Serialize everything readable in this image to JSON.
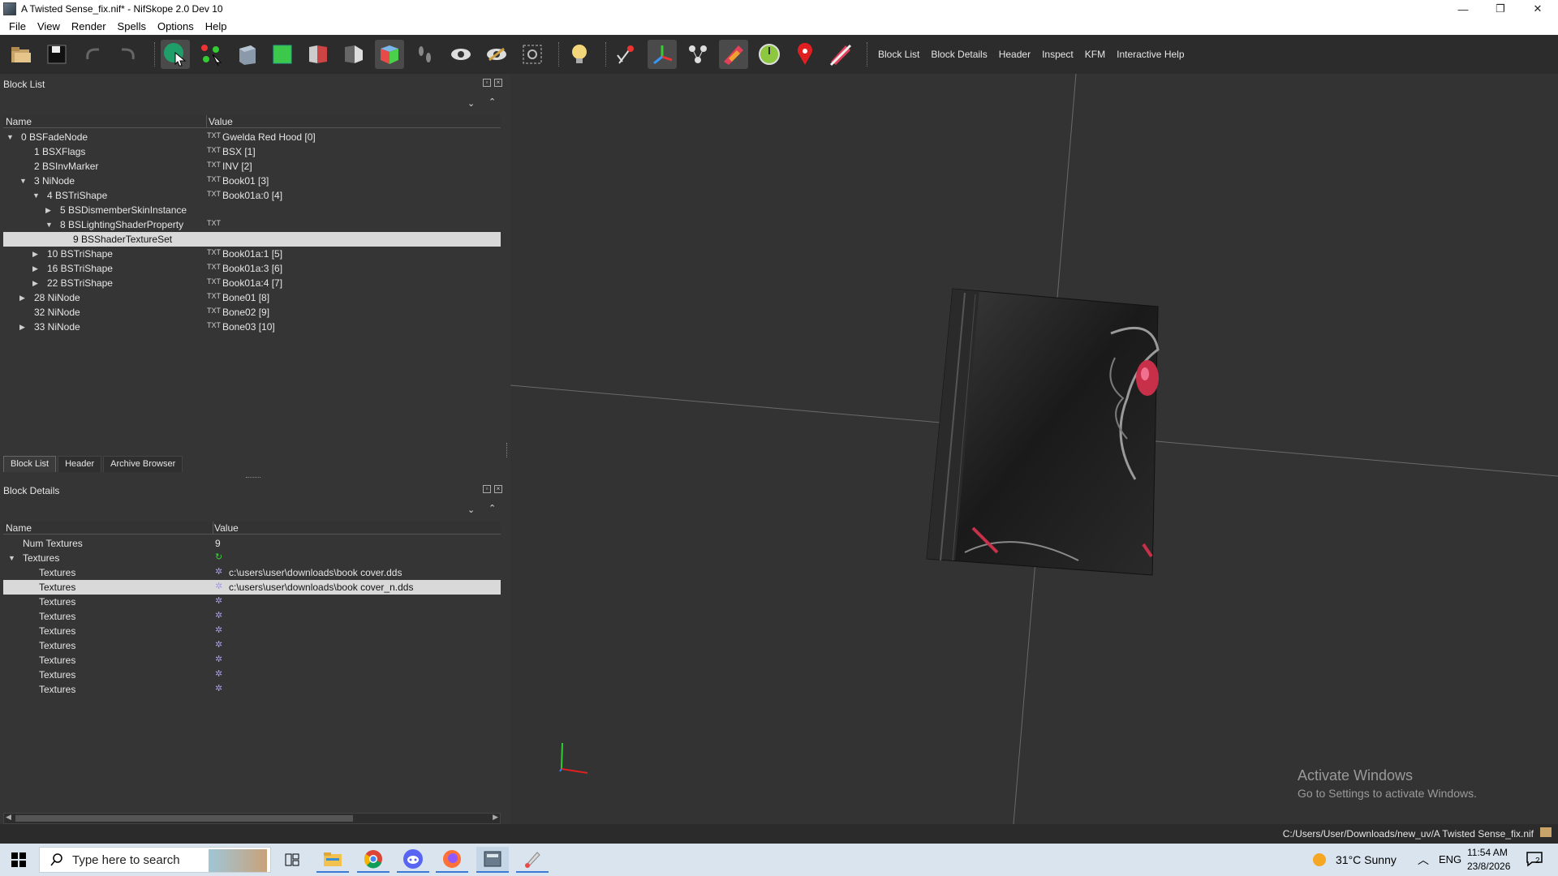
{
  "window": {
    "title": "A Twisted Sense_fix.nif* - NifSkope 2.0 Dev 10",
    "minimize_glyph": "—",
    "restore_glyph": "❐",
    "close_glyph": "✕"
  },
  "menu": [
    "File",
    "View",
    "Render",
    "Spells",
    "Options",
    "Help"
  ],
  "toolbar": {
    "icons": [
      "load-icon",
      "save-icon",
      "undo-icon",
      "redo-icon",
      "select-object-icon",
      "select-vertex-icon",
      "view-box-icon",
      "view-front-icon",
      "view-side-icon",
      "view-flip-icon",
      "view-perspective-icon",
      "walk-icon",
      "show-icon",
      "hide-icon",
      "screenshot-icon",
      "lighting-icon",
      "pick-icon",
      "axes-icon",
      "nodes-icon",
      "textures-icon",
      "color-wheel-icon",
      "marker-icon",
      "no-textures-icon"
    ],
    "labels": [
      "Block List",
      "Block Details",
      "Header",
      "Inspect",
      "KFM",
      "Interactive Help"
    ]
  },
  "block_list": {
    "title": "Block List",
    "col_name": "Name",
    "col_value": "Value",
    "rows": [
      {
        "arrow": "▼",
        "name": "0 BSFadeNode",
        "value": "Gwelda Red Hood [0]"
      },
      {
        "arrow": "",
        "name": "1 BSXFlags",
        "value": "BSX [1]"
      },
      {
        "arrow": "",
        "name": "2 BSInvMarker",
        "value": "INV [2]"
      },
      {
        "arrow": "▼",
        "name": "3 NiNode",
        "value": "Book01 [3]"
      },
      {
        "arrow": "▼",
        "name": "4 BSTriShape",
        "value": "Book01a:0 [4]"
      },
      {
        "arrow": "▶",
        "name": "5 BSDismemberSkinInstance",
        "value": ""
      },
      {
        "arrow": "▼",
        "name": "8 BSLightingShaderProperty",
        "value": ""
      },
      {
        "arrow": "",
        "name": "9 BSShaderTextureSet",
        "value": ""
      },
      {
        "arrow": "▶",
        "name": "10 BSTriShape",
        "value": "Book01a:1 [5]"
      },
      {
        "arrow": "▶",
        "name": "16 BSTriShape",
        "value": "Book01a:3 [6]"
      },
      {
        "arrow": "▶",
        "name": "22 BSTriShape",
        "value": "Book01a:4 [7]"
      },
      {
        "arrow": "▶",
        "name": "28 NiNode",
        "value": "Bone01 [8]"
      },
      {
        "arrow": "",
        "name": "32 NiNode",
        "value": "Bone02 [9]"
      },
      {
        "arrow": "▶",
        "name": "33 NiNode",
        "value": "Bone03 [10]"
      }
    ],
    "tabs": [
      "Block List",
      "Header",
      "Archive Browser"
    ]
  },
  "block_details": {
    "title": "Block Details",
    "col_name": "Name",
    "col_value": "Value",
    "rows": [
      {
        "arrow": "",
        "name": "Num Textures",
        "value": "9"
      },
      {
        "arrow": "▼",
        "name": "Textures",
        "value": ""
      },
      {
        "arrow": "",
        "name": "Textures",
        "value": "c:\\users\\user\\downloads\\book cover.dds"
      },
      {
        "arrow": "",
        "name": "Textures",
        "value": "c:\\users\\user\\downloads\\book cover_n.dds"
      },
      {
        "arrow": "",
        "name": "Textures",
        "value": ""
      },
      {
        "arrow": "",
        "name": "Textures",
        "value": ""
      },
      {
        "arrow": "",
        "name": "Textures",
        "value": ""
      },
      {
        "arrow": "",
        "name": "Textures",
        "value": ""
      },
      {
        "arrow": "",
        "name": "Textures",
        "value": ""
      },
      {
        "arrow": "",
        "name": "Textures",
        "value": ""
      },
      {
        "arrow": "",
        "name": "Textures",
        "value": ""
      }
    ]
  },
  "viewport": {
    "watermark_title": "Activate Windows",
    "watermark_sub": "Go to Settings to activate Windows."
  },
  "status": {
    "path": "C:/Users/User/Downloads/new_uv/A Twisted Sense_fix.nif"
  },
  "taskbar": {
    "search_placeholder": "Type here to search",
    "weather": "31°C  Sunny",
    "lang": "ENG",
    "time": "11:54 AM",
    "date": "23/8/2026",
    "notifications": "2"
  },
  "colors": {
    "selected_row": "#d9d9d9",
    "panel_bg": "#353535",
    "viewport_bg": "#333333"
  }
}
